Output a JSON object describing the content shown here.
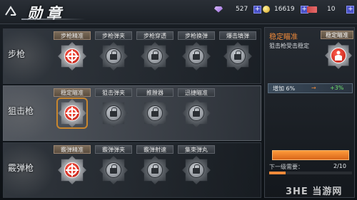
{
  "header": {
    "title": "勋章",
    "currency": [
      {
        "icon": "gem-icon",
        "value": "527"
      },
      {
        "icon": "coin-icon",
        "value": "16619"
      },
      {
        "icon": "ticket-icon",
        "value": "10"
      }
    ]
  },
  "rows": [
    {
      "label": "步枪",
      "slots": [
        {
          "name": "步枪精准",
          "state": "unlocked"
        },
        {
          "name": "步枪弹夹",
          "state": "locked"
        },
        {
          "name": "步枪穿透",
          "state": "locked"
        },
        {
          "name": "步枪换弹",
          "state": "locked"
        },
        {
          "name": "爆击填弹",
          "state": "locked"
        }
      ]
    },
    {
      "label": "狙击枪",
      "slots": [
        {
          "name": "稳定瞄准",
          "state": "selected"
        },
        {
          "name": "狙击弹夹",
          "state": "locked"
        },
        {
          "name": "推膛器",
          "state": "locked"
        },
        {
          "name": "迅捷瞄准",
          "state": "locked"
        }
      ]
    },
    {
      "label": "霰弹枪",
      "slots": [
        {
          "name": "霰弹精准",
          "state": "unlocked"
        },
        {
          "name": "霰弹弹夹",
          "state": "locked"
        },
        {
          "name": "霰弹射速",
          "state": "locked"
        },
        {
          "name": "集束弹丸",
          "state": "locked"
        }
      ]
    }
  ],
  "panel": {
    "name": "稳定瞄准",
    "tag": "稳定瞄准",
    "desc": "狙击枪受击稳定",
    "stat": {
      "label": "增加 6%",
      "arrow": "→",
      "increase": "+3%"
    },
    "next_label": "下一级需要：",
    "next_value": "2/10",
    "progress": 0.2
  },
  "watermark": "3HE 当游网"
}
